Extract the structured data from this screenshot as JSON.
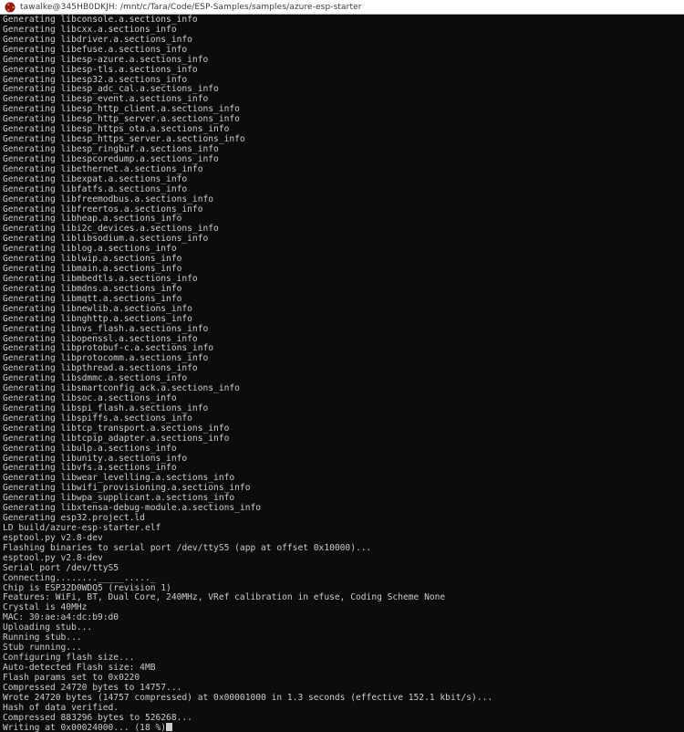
{
  "window": {
    "title": "tawalke@345HB0DKJH: /mnt/c/Tara/Code/ESP-Samples/samples/azure-esp-starter",
    "icon": "ubuntu-logo-icon",
    "background_color": "#0c0c0c",
    "titlebar_color": "#ffffff",
    "text_color": "#cccccc"
  },
  "terminal": {
    "prompt_user": "tawalke",
    "prompt_host": "345HB0DKJH",
    "working_directory": "/mnt/c/Tara/Code/ESP-Samples/samples/azure-esp-starter",
    "cursor_visible": true,
    "lines": [
      "Generating libconsole.a.sections_info",
      "Generating libcxx.a.sections_info",
      "Generating libdriver.a.sections_info",
      "Generating libefuse.a.sections_info",
      "Generating libesp-azure.a.sections_info",
      "Generating libesp-tls.a.sections_info",
      "Generating libesp32.a.sections_info",
      "Generating libesp_adc_cal.a.sections_info",
      "Generating libesp_event.a.sections_info",
      "Generating libesp_http_client.a.sections_info",
      "Generating libesp_http_server.a.sections_info",
      "Generating libesp_https_ota.a.sections_info",
      "Generating libesp_https_server.a.sections_info",
      "Generating libesp_ringbuf.a.sections_info",
      "Generating libespcoredump.a.sections_info",
      "Generating libethernet.a.sections_info",
      "Generating libexpat.a.sections_info",
      "Generating libfatfs.a.sections_info",
      "Generating libfreemodbus.a.sections_info",
      "Generating libfreertos.a.sections_info",
      "Generating libheap.a.sections_info",
      "Generating libi2c_devices.a.sections_info",
      "Generating liblibsodium.a.sections_info",
      "Generating liblog.a.sections_info",
      "Generating liblwip.a.sections_info",
      "Generating libmain.a.sections_info",
      "Generating libmbedtls.a.sections_info",
      "Generating libmdns.a.sections_info",
      "Generating libmqtt.a.sections_info",
      "Generating libnewlib.a.sections_info",
      "Generating libnghttp.a.sections_info",
      "Generating libnvs_flash.a.sections_info",
      "Generating libopenssl.a.sections_info",
      "Generating libprotobuf-c.a.sections_info",
      "Generating libprotocomm.a.sections_info",
      "Generating libpthread.a.sections_info",
      "Generating libsdmmc.a.sections_info",
      "Generating libsmartconfig_ack.a.sections_info",
      "Generating libsoc.a.sections_info",
      "Generating libspi_flash.a.sections_info",
      "Generating libspiffs.a.sections_info",
      "Generating libtcp_transport.a.sections_info",
      "Generating libtcpip_adapter.a.sections_info",
      "Generating libulp.a.sections_info",
      "Generating libunity.a.sections_info",
      "Generating libvfs.a.sections_info",
      "Generating libwear_levelling.a.sections_info",
      "Generating libwifi_provisioning.a.sections_info",
      "Generating libwpa_supplicant.a.sections_info",
      "Generating libxtensa-debug-module.a.sections_info",
      "Generating esp32.project.ld",
      "LD build/azure-esp-starter.elf",
      "esptool.py v2.8-dev",
      "Flashing binaries to serial port /dev/ttyS5 (app at offset 0x10000)...",
      "esptool.py v2.8-dev",
      "Serial port /dev/ttyS5",
      "Connecting........_____....._",
      "Chip is ESP32D0WDQ5 (revision 1)",
      "Features: WiFi, BT, Dual Core, 240MHz, VRef calibration in efuse, Coding Scheme None",
      "Crystal is 40MHz",
      "MAC: 30:ae:a4:dc:b9:d0",
      "Uploading stub...",
      "Running stub...",
      "Stub running...",
      "Configuring flash size...",
      "Auto-detected Flash size: 4MB",
      "Flash params set to 0x0220",
      "Compressed 24720 bytes to 14757...",
      "Wrote 24720 bytes (14757 compressed) at 0x00001000 in 1.3 seconds (effective 152.1 kbit/s)...",
      "Hash of data verified.",
      "Compressed 883296 bytes to 526268...",
      "Writing at 0x00024000... (18 %)"
    ]
  }
}
